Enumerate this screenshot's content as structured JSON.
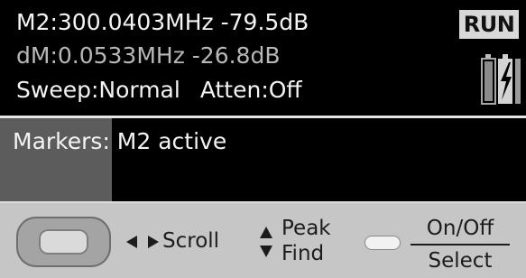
{
  "status": {
    "marker_line": "M2:300.0403MHz -79.5dB",
    "delta_line": "dM:0.0533MHz -26.8dB",
    "sweep": "Sweep:Normal",
    "atten": "Atten:Off",
    "run_state": "RUN",
    "battery_icon": "battery-charging-icon"
  },
  "message": {
    "text": "Markers: M2 active"
  },
  "softkeys": {
    "joystick_icon": "joystick-button-icon",
    "scroll_icon": "left-right-arrows-icon",
    "scroll_label": "Scroll",
    "peak_icon": "up-down-arrows-icon",
    "peak_line1": "Peak",
    "peak_line2": "Find",
    "select_key_icon": "small-key-icon",
    "onoff_label": "On/Off",
    "select_label": "Select"
  },
  "colors": {
    "background": "#000000",
    "text": "#f4f4f4",
    "dim_text": "#b8b8b8",
    "highlight": "#5c5c5c",
    "softkey_bar": "#c6c6c6"
  }
}
